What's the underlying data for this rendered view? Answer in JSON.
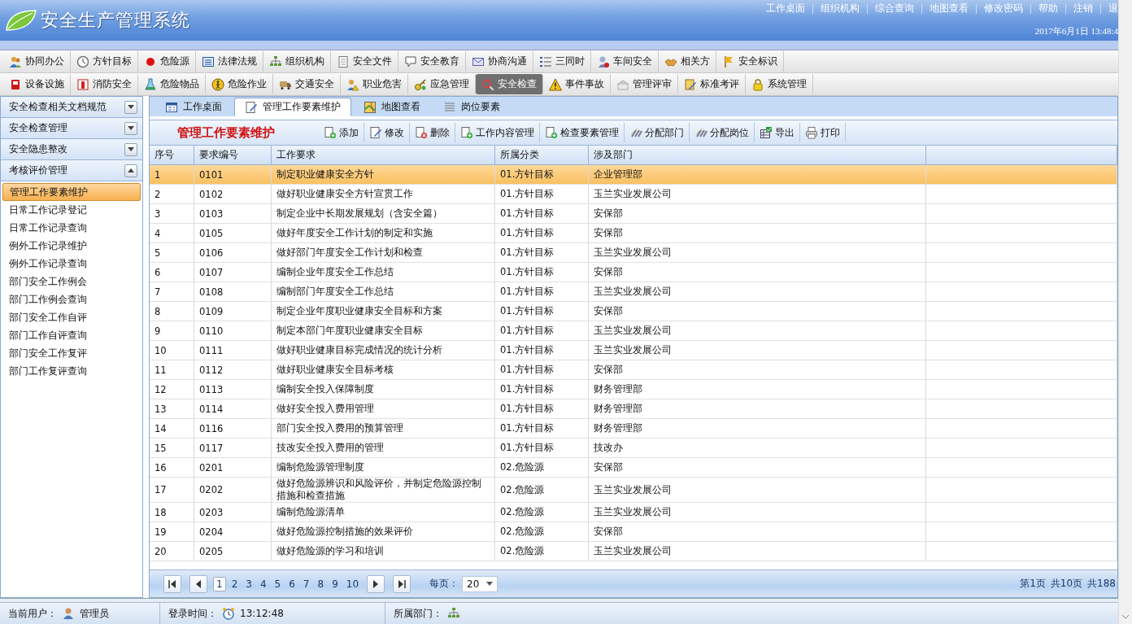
{
  "header": {
    "title": "安全生产管理系统",
    "links": [
      "工作桌面",
      "组织机构",
      "综合查询",
      "地图查看",
      "修改密码",
      "帮助",
      "注销",
      "退"
    ],
    "datetime": "2017年6月1日  13:48:4"
  },
  "modules": [
    [
      {
        "label": "协同办公",
        "selected": false
      },
      {
        "label": "方针目标",
        "selected": false
      },
      {
        "label": "危险源",
        "selected": false
      },
      {
        "label": "法律法规",
        "selected": false
      },
      {
        "label": "组织机构",
        "selected": false
      },
      {
        "label": "安全文件",
        "selected": false
      },
      {
        "label": "安全教育",
        "selected": false
      },
      {
        "label": "协商沟通",
        "selected": false
      },
      {
        "label": "三同时",
        "selected": false
      },
      {
        "label": "车间安全",
        "selected": false
      },
      {
        "label": "相关方",
        "selected": false
      },
      {
        "label": "安全标识",
        "selected": false
      }
    ],
    [
      {
        "label": "设备设施",
        "selected": false
      },
      {
        "label": "消防安全",
        "selected": false
      },
      {
        "label": "危险物品",
        "selected": false
      },
      {
        "label": "危险作业",
        "selected": false
      },
      {
        "label": "交通安全",
        "selected": false
      },
      {
        "label": "职业危害",
        "selected": false
      },
      {
        "label": "应急管理",
        "selected": false
      },
      {
        "label": "安全检查",
        "selected": true
      },
      {
        "label": "事件事故",
        "selected": false
      },
      {
        "label": "管理评审",
        "selected": false
      },
      {
        "label": "标准考评",
        "selected": false
      },
      {
        "label": "系统管理",
        "selected": false
      }
    ]
  ],
  "sidebar": {
    "sections": [
      {
        "title": "安全检查相关文档规范",
        "expanded": false
      },
      {
        "title": "安全检查管理",
        "expanded": false
      },
      {
        "title": "安全隐患整改",
        "expanded": false
      },
      {
        "title": "考核评价管理",
        "expanded": true,
        "items": [
          {
            "label": "管理工作要素维护",
            "selected": true
          },
          {
            "label": "日常工作记录登记",
            "selected": false
          },
          {
            "label": "日常工作记录查询",
            "selected": false
          },
          {
            "label": "例外工作记录维护",
            "selected": false
          },
          {
            "label": "例外工作记录查询",
            "selected": false
          },
          {
            "label": "部门安全工作例会",
            "selected": false
          },
          {
            "label": "部门工作例会查询",
            "selected": false
          },
          {
            "label": "部门安全工作自评",
            "selected": false
          },
          {
            "label": "部门工作自评查询",
            "selected": false
          },
          {
            "label": "部门安全工作复评",
            "selected": false
          },
          {
            "label": "部门工作复评查询",
            "selected": false
          }
        ]
      }
    ]
  },
  "tabs": [
    {
      "label": "工作桌面",
      "selected": false
    },
    {
      "label": "管理工作要素维护",
      "selected": true
    },
    {
      "label": "地图查看",
      "selected": false
    },
    {
      "label": "岗位要素",
      "selected": false
    }
  ],
  "panel_title": "管理工作要素维护",
  "actions": [
    "添加",
    "修改",
    "删除",
    "工作内容管理",
    "检查要素管理",
    "分配部门",
    "分配岗位",
    "导出",
    "打印"
  ],
  "table": {
    "columns": [
      "序号",
      "要求编号",
      "工作要求",
      "所属分类",
      "涉及部门"
    ],
    "rows": [
      {
        "no": "1",
        "code": "0101",
        "requirement": "制定职业健康安全方针",
        "category": "01.方针目标",
        "department": "企业管理部",
        "selected": true
      },
      {
        "no": "2",
        "code": "0102",
        "requirement": "做好职业健康安全方针宣贯工作",
        "category": "01.方针目标",
        "department": "玉兰实业发展公司",
        "selected": false
      },
      {
        "no": "3",
        "code": "0103",
        "requirement": "制定企业中长期发展规划（含安全篇）",
        "category": "01.方针目标",
        "department": "安保部",
        "selected": false
      },
      {
        "no": "4",
        "code": "0105",
        "requirement": "做好年度安全工作计划的制定和实施",
        "category": "01.方针目标",
        "department": "安保部",
        "selected": false
      },
      {
        "no": "5",
        "code": "0106",
        "requirement": "做好部门年度安全工作计划和检查",
        "category": "01.方针目标",
        "department": "玉兰实业发展公司",
        "selected": false
      },
      {
        "no": "6",
        "code": "0107",
        "requirement": "编制企业年度安全工作总结",
        "category": "01.方针目标",
        "department": "安保部",
        "selected": false
      },
      {
        "no": "7",
        "code": "0108",
        "requirement": "编制部门年度安全工作总结",
        "category": "01.方针目标",
        "department": "玉兰实业发展公司",
        "selected": false
      },
      {
        "no": "8",
        "code": "0109",
        "requirement": "制定企业年度职业健康安全目标和方案",
        "category": "01.方针目标",
        "department": "安保部",
        "selected": false
      },
      {
        "no": "9",
        "code": "0110",
        "requirement": "制定本部门年度职业健康安全目标",
        "category": "01.方针目标",
        "department": "玉兰实业发展公司",
        "selected": false
      },
      {
        "no": "10",
        "code": "0111",
        "requirement": "做好职业健康目标完成情况的统计分析",
        "category": "01.方针目标",
        "department": "玉兰实业发展公司",
        "selected": false
      },
      {
        "no": "11",
        "code": "0112",
        "requirement": "做好职业健康安全目标考核",
        "category": "01.方针目标",
        "department": "安保部",
        "selected": false
      },
      {
        "no": "12",
        "code": "0113",
        "requirement": "编制安全投入保障制度",
        "category": "01.方针目标",
        "department": "财务管理部",
        "selected": false
      },
      {
        "no": "13",
        "code": "0114",
        "requirement": "做好安全投入费用管理",
        "category": "01.方针目标",
        "department": "财务管理部",
        "selected": false
      },
      {
        "no": "14",
        "code": "0116",
        "requirement": "部门安全投入费用的预算管理",
        "category": "01.方针目标",
        "department": "财务管理部",
        "selected": false
      },
      {
        "no": "15",
        "code": "0117",
        "requirement": "技改安全投入费用的管理",
        "category": "01.方针目标",
        "department": "技改办",
        "selected": false
      },
      {
        "no": "16",
        "code": "0201",
        "requirement": "编制危险源管理制度",
        "category": "02.危险源",
        "department": "安保部",
        "selected": false
      },
      {
        "no": "17",
        "code": "0202",
        "requirement": "做好危险源辨识和风险评价，并制定危险源控制措施和检查措施",
        "category": "02.危险源",
        "department": "玉兰实业发展公司",
        "selected": false
      },
      {
        "no": "18",
        "code": "0203",
        "requirement": "编制危险源清单",
        "category": "02.危险源",
        "department": "玉兰实业发展公司",
        "selected": false
      },
      {
        "no": "19",
        "code": "0204",
        "requirement": "做好危险源控制措施的效果评价",
        "category": "02.危险源",
        "department": "安保部",
        "selected": false
      },
      {
        "no": "20",
        "code": "0205",
        "requirement": "做好危险源的学习和培训",
        "category": "02.危险源",
        "department": "玉兰实业发展公司",
        "selected": false
      }
    ]
  },
  "pager": {
    "pages": [
      {
        "label": "1",
        "selected": true
      },
      {
        "label": "2",
        "selected": false
      },
      {
        "label": "3",
        "selected": false
      },
      {
        "label": "4",
        "selected": false
      },
      {
        "label": "5",
        "selected": false
      },
      {
        "label": "6",
        "selected": false
      },
      {
        "label": "7",
        "selected": false
      },
      {
        "label": "8",
        "selected": false
      },
      {
        "label": "9",
        "selected": false
      },
      {
        "label": "10",
        "selected": false
      }
    ],
    "per_page_label": "每页：",
    "per_page": "20",
    "info": [
      "第1页",
      "共10页",
      "共188"
    ]
  },
  "status_bar": {
    "user_label": "当前用户：",
    "user": "管理员",
    "login_label": "登录时间：",
    "login_time": "13:12:48",
    "dept_label": "所属部门："
  }
}
